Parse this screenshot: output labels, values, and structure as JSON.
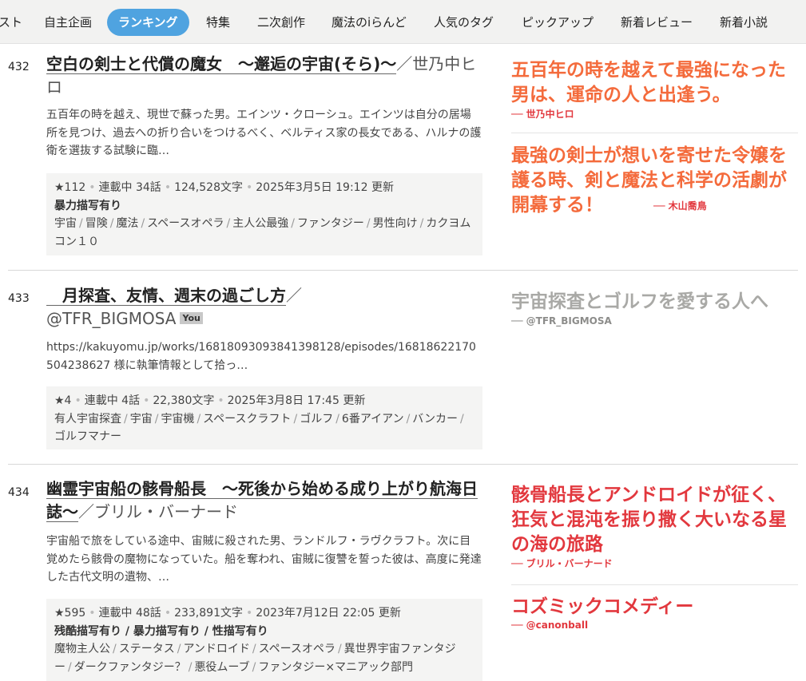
{
  "nav": {
    "items": [
      {
        "label": "スト",
        "active": false
      },
      {
        "label": "自主企画",
        "active": false
      },
      {
        "label": "ランキング",
        "active": true
      },
      {
        "label": "特集",
        "active": false
      },
      {
        "label": "二次創作",
        "active": false
      },
      {
        "label": "魔法のiらんど",
        "active": false
      },
      {
        "label": "人気のタグ",
        "active": false
      },
      {
        "label": "ピックアップ",
        "active": false
      },
      {
        "label": "新着レビュー",
        "active": false
      },
      {
        "label": "新着小説",
        "active": false
      }
    ]
  },
  "works": [
    {
      "rank": "432",
      "title": "空白の剣士と代償の魔女　～邂逅の宇宙(そら)～",
      "slash": "／",
      "author": "世乃中ヒロ",
      "you": "",
      "intro": "五百年の時を越え、現世で蘇った男。エインツ・クローシュ。エインツは自分の居場所を見つけ、過去への折り合いをつけるべく、ベルティス家の長女である、ハルナの護衛を選抜する試験に臨…",
      "stars": "★112",
      "status": "連載中 34話",
      "chars": "124,528文字",
      "updated": "2025年3月5日 19:12 更新",
      "flags": "暴力描写有り",
      "tags": [
        "宇宙",
        "冒険",
        "魔法",
        "スペースオペラ",
        "主人公最強",
        "ファンタジー",
        "男性向け",
        "カクヨムコン１０"
      ],
      "reviews": [
        {
          "text": "五百年の時を越えて最強になった男は、運命の人と出逢う。",
          "by": "── 世乃中ヒロ"
        },
        {
          "text": "最強の剣士が想いを寄せた令嬢を護る時、剣と魔法と科学の活劇が開幕する！",
          "by": "── 木山喬鳥"
        }
      ]
    },
    {
      "rank": "433",
      "title": "　月探査、友情、週末の過ごし方",
      "slash": "／",
      "author": "@TFR_BIGMOSA",
      "you": "You",
      "intro": "https://kakuyomu.jp/works/16818093093841398128/episodes/16818622170504238627 様に執筆情報として拾っ…",
      "stars": "★4",
      "status": "連載中 4話",
      "chars": "22,380文字",
      "updated": "2025年3月8日 17:45 更新",
      "flags": "",
      "tags": [
        "有人宇宙探査",
        "宇宙",
        "宇宙機",
        "スペースクラフト",
        "ゴルフ",
        "6番アイアン",
        "バンカー",
        "ゴルフマナー"
      ],
      "reviews": [
        {
          "text": "宇宙探査とゴルフを愛する人へ",
          "by": "── @TFR_BIGMOSA"
        }
      ]
    },
    {
      "rank": "434",
      "title": "幽霊宇宙船の骸骨船長　～死後から始める成り上がり航海日誌～",
      "slash": "／",
      "author": "ブリル・バーナード",
      "you": "",
      "intro": "宇宙船で旅をしている途中、宙賊に殺された男、ランドルフ・ラヴクラフト。次に目覚めたら骸骨の魔物になっていた。船を奪われ、宙賊に復讐を誓った彼は、高度に発達した古代文明の遺物、…",
      "stars": "★595",
      "status": "連載中 48話",
      "chars": "233,891文字",
      "updated": "2023年7月12日 22:05 更新",
      "flags": "残酷描写有り / 暴力描写有り / 性描写有り",
      "tags": [
        "魔物主人公",
        "ステータス",
        "アンドロイド",
        "スペースオペラ",
        "異世界宇宙ファンタジー",
        "ダークファンタジー？",
        "悪役ムーブ",
        "ファンタジー×マニアック部門"
      ],
      "reviews": [
        {
          "text": "骸骨船長とアンドロイドが征く、狂気と混沌を振り撒く大いなる星の海の旅路",
          "by": "── ブリル・バーナード"
        },
        {
          "text": "コズミックコメディー",
          "by": "── @canonball"
        }
      ]
    }
  ]
}
